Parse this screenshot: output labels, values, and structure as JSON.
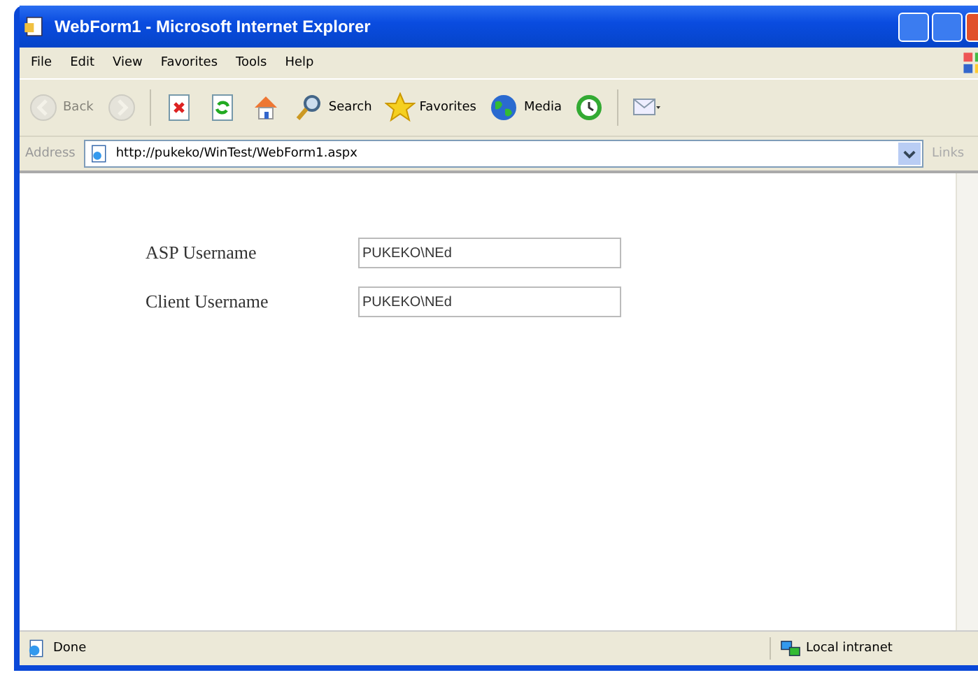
{
  "window": {
    "title": "WebForm1 - Microsoft Internet Explorer"
  },
  "menu": [
    "File",
    "Edit",
    "View",
    "Favorites",
    "Tools",
    "Help"
  ],
  "toolbar": [
    {
      "kind": "back",
      "label": "Back",
      "disabled": true
    },
    {
      "kind": "forward",
      "disabled": true
    },
    {
      "kind": "stop",
      "disabled": false
    },
    {
      "kind": "refresh",
      "disabled": false
    },
    {
      "kind": "home",
      "disabled": false
    },
    {
      "kind": "search",
      "label": "Search",
      "disabled": false
    },
    {
      "kind": "favorites",
      "label": "Favorites",
      "disabled": false
    },
    {
      "kind": "media",
      "label": "Media",
      "disabled": false
    },
    {
      "kind": "history",
      "disabled": false
    },
    {
      "kind": "mail",
      "disabled": false
    }
  ],
  "address_bar": {
    "label": "Address",
    "value": "http://pukeko/WinTest/WebForm1.aspx",
    "links": "Links"
  },
  "form": [
    {
      "label": "ASP Username",
      "value": "PUKEKO\\NEd"
    },
    {
      "label": "Client Username",
      "value": "PUKEKO\\NEd"
    }
  ],
  "status_bar": {
    "text": "Done",
    "zone": "Local intranet"
  }
}
